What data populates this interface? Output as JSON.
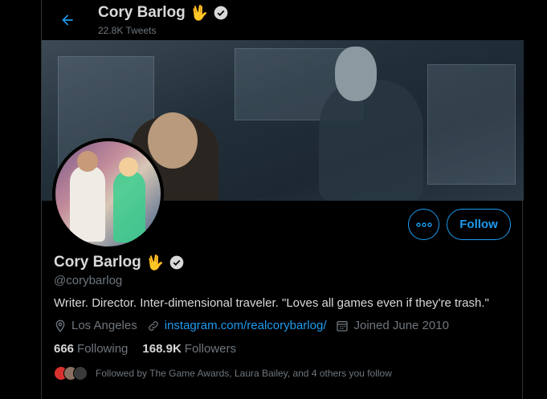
{
  "header": {
    "name": "Cory Barlog",
    "tweet_count": "22.8K Tweets"
  },
  "profile": {
    "name": "Cory Barlog",
    "handle": "@corybarlog",
    "bio": "Writer. Director. Inter-dimensional traveler. \"Loves all games even if they're trash.\"",
    "location": "Los Angeles",
    "website": "instagram.com/realcorybarlog/",
    "joined": "Joined June 2010",
    "following_count": "666",
    "following_label": "Following",
    "followers_count": "168.9K",
    "followers_label": "Followers",
    "followed_by": "Followed by The Game Awards, Laura Bailey, and 4 others you follow"
  },
  "actions": {
    "follow_label": "Follow"
  },
  "icons": {
    "back": "arrow-left-icon",
    "verified": "verified-badge-icon",
    "more": "more-dots-icon",
    "location": "location-pin-icon",
    "link": "link-icon",
    "calendar": "calendar-icon",
    "hand": "vulcan-salute-emoji"
  },
  "colors": {
    "accent": "#1d9bf0",
    "background": "#000000",
    "text_primary": "#d9d9d9",
    "text_secondary": "#6e767d"
  }
}
